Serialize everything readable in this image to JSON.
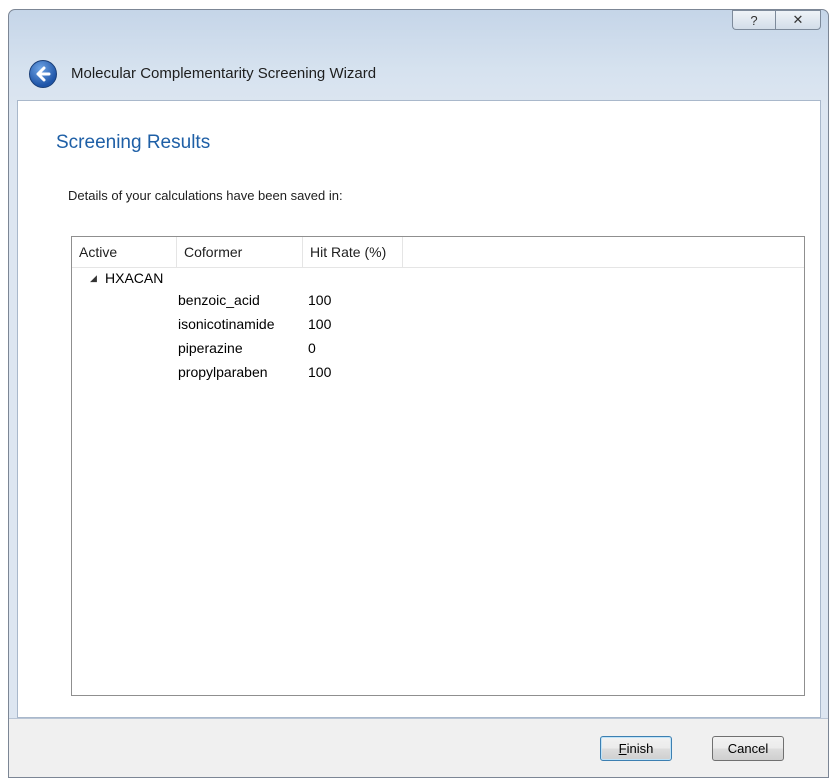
{
  "window": {
    "title": "Molecular Complementarity Screening Wizard",
    "help_button": "?",
    "close_button": "✕"
  },
  "page": {
    "heading": "Screening Results",
    "details_text": "Details of your calculations have been saved in:"
  },
  "tree": {
    "columns": [
      "Active",
      "Coformer",
      "Hit Rate (%)"
    ],
    "active": {
      "label": "HXACAN",
      "expanded": true,
      "expander_glyph": "◢"
    },
    "rows": [
      {
        "coformer": "benzoic_acid",
        "hit_rate": "100"
      },
      {
        "coformer": "isonicotinamide",
        "hit_rate": "100"
      },
      {
        "coformer": "piperazine",
        "hit_rate": "0"
      },
      {
        "coformer": "propylparaben",
        "hit_rate": "100"
      }
    ]
  },
  "buttons": {
    "finish_accel": "F",
    "finish_rest": "inish",
    "cancel": "Cancel"
  },
  "colors": {
    "heading": "#1e5fa6",
    "frame": "#d6e2ef",
    "default_button_border": "#3c7fb1"
  }
}
